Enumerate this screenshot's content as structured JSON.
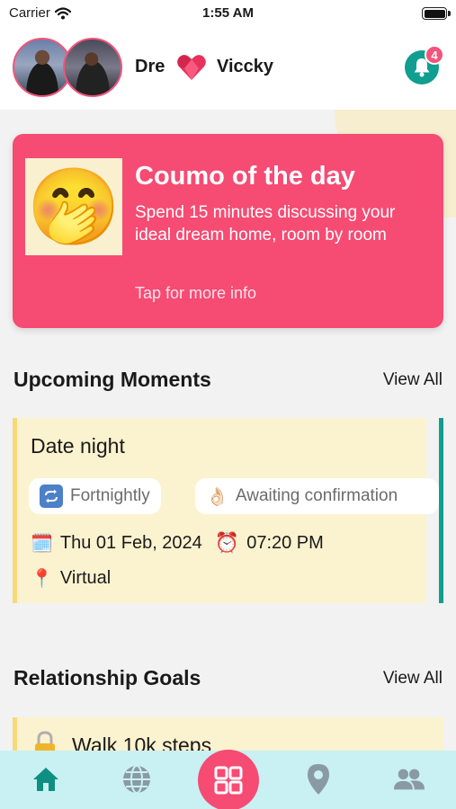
{
  "status_bar": {
    "carrier": "Carrier",
    "time": "1:55 AM"
  },
  "header": {
    "partner_1": "Dre",
    "partner_2": "Viccky",
    "notification_count": "4"
  },
  "coumo": {
    "title": "Coumo of the day",
    "description": "Spend 15 minutes discussing your ideal dream home, room by room",
    "link": "Tap for more info",
    "emoji": "🤭"
  },
  "upcoming": {
    "title": "Upcoming Moments",
    "view_all": "View All",
    "moment": {
      "title": "Date night",
      "frequency": "Fortnightly",
      "status_emoji": "👌🏻",
      "status": "Awaiting confirmation",
      "date_emoji": "🗓️",
      "date": "Thu 01 Feb, 2024",
      "time_emoji": "⏰",
      "time": "07:20 PM",
      "location_emoji": "📍",
      "location": "Virtual"
    }
  },
  "goals": {
    "title": "Relationship Goals",
    "view_all": "View All",
    "items": [
      {
        "label": "Walk 10k steps"
      }
    ]
  },
  "nav": {
    "icons": [
      "home-icon",
      "globe-icon",
      "dashboard-icon",
      "location-icon",
      "people-icon"
    ]
  },
  "colors": {
    "brand_pink": "#f64b73",
    "teal": "#0f9e8f",
    "card_yellow": "#fbf2cf",
    "nav_bg": "#c9f1f3"
  }
}
